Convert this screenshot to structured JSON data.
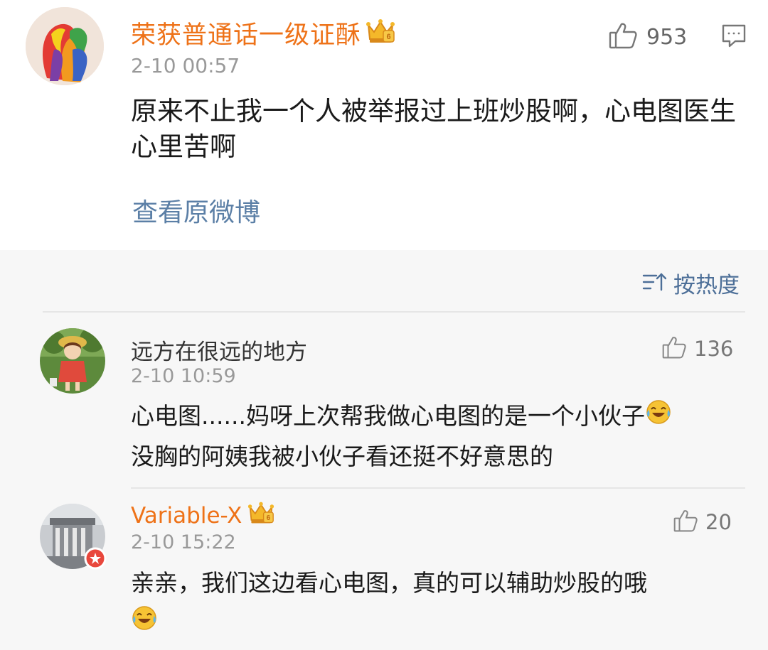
{
  "post": {
    "author": "荣获普通话一级证酥",
    "time": "2-10 00:57",
    "like_count": "953",
    "text": "原来不止我一个人被举报过上班炒股啊，心电图医生心里苦啊",
    "view_original_label": "查看原微博",
    "avatar_icon": "rainbow-heads-avatar",
    "author_badge_icon": "crown-vip-icon",
    "name_color": "#ee7218"
  },
  "comments_header": {
    "sort_label": "按热度",
    "sort_icon": "sort-icon"
  },
  "comments": [
    {
      "author": "远方在很远的地方",
      "time": "2-10 10:59",
      "like_count": "136",
      "text": "心电图......妈呀上次帮我做心电图的是一个小伙子",
      "text_line2": "没胸的阿姨我被小伙子看还挺不好意思的",
      "emoji_icon": "laughing-crying-emoji",
      "avatar_icon": "totoro-girl-avatar"
    },
    {
      "author": "Variable-X",
      "time": "2-10 15:22",
      "like_count": "20",
      "text": "亲亲，我们这边看心电图，真的可以辅助炒股的哦",
      "emoji_icon": "laughing-crying-emoji",
      "avatar_icon": "building-avatar",
      "author_badge_icon": "crown-vip-icon",
      "name_color": "#ee7218"
    }
  ],
  "colors": {
    "accent_orange": "#ee7218",
    "link_blue": "#5b7fa6",
    "comments_bg": "#f7f7f7"
  }
}
